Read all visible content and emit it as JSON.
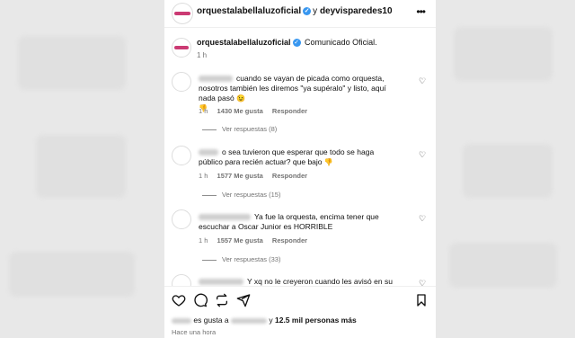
{
  "header": {
    "username": "orquestalabellaluzoficial",
    "conjunction": "y",
    "coauthor": "deyvisparedes10",
    "more_icon": "more-horizontal-icon"
  },
  "caption": {
    "username": "orquestalabellaluzoficial",
    "text": "Comunicado Oficial.",
    "time": "1 h"
  },
  "comments": [
    {
      "text": "cuando se vayan de picada como orquesta, nosotros también les diremos \"ya supéralo\" y listo, aquí nada pasó",
      "emoji": "😉",
      "emoji2": "👎",
      "time": "1 h",
      "likes": "1430 Me gusta",
      "reply": "Responder",
      "view_replies": "Ver respuestas (8)"
    },
    {
      "text": "o sea tuvieron que esperar que todo se haga público para recién actuar? que bajo",
      "emoji": "👎",
      "time": "1 h",
      "likes": "1577 Me gusta",
      "reply": "Responder",
      "view_replies": "Ver respuestas (15)"
    },
    {
      "text": "Ya fue la orquesta, encima tener que escuchar a Oscar Junior es HORRIBLE",
      "time": "1 h",
      "likes": "1557 Me gusta",
      "reply": "Responder",
      "view_replies": "Ver respuestas (33)"
    },
    {
      "text": "Y xq no le creyeron cuando les avisó en su"
    }
  ],
  "actions": {
    "like_icon": "heart-icon",
    "comment_icon": "comment-icon",
    "share_icon": "repost-icon",
    "send_icon": "send-icon",
    "save_icon": "bookmark-icon"
  },
  "likes": {
    "prefix": "es gusta a",
    "middle": "y",
    "count": "12.5 mil personas más"
  },
  "posted": "Hace una hora",
  "colors": {
    "verified": "#3897f0",
    "muted": "#737373",
    "text": "#111111"
  }
}
